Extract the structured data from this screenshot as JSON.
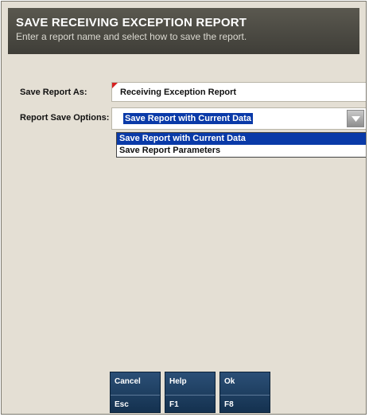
{
  "header": {
    "title": "SAVE RECEIVING EXCEPTION REPORT",
    "subtitle": "Enter a report name and select how to save the report."
  },
  "form": {
    "save_as_label": "Save Report As:",
    "save_as_value": "Receiving Exception Report",
    "options_label": "Report Save Options:",
    "options_selected": "Save Report with Current Data",
    "options": [
      "Save Report with Current Data",
      "Save Report Parameters"
    ]
  },
  "buttons": [
    {
      "label": "Cancel",
      "key": "Esc"
    },
    {
      "label": "Help",
      "key": "F1"
    },
    {
      "label": "Ok",
      "key": "F8"
    }
  ],
  "colors": {
    "header_bg": "#4a4943",
    "panel_bg": "#e4dfd4",
    "selection": "#0a3aa8",
    "button_bg": "#1f4468",
    "required_flag": "#d62020"
  },
  "icons": {
    "dropdown": "chevron-down-icon",
    "required": "required-flag-icon"
  }
}
